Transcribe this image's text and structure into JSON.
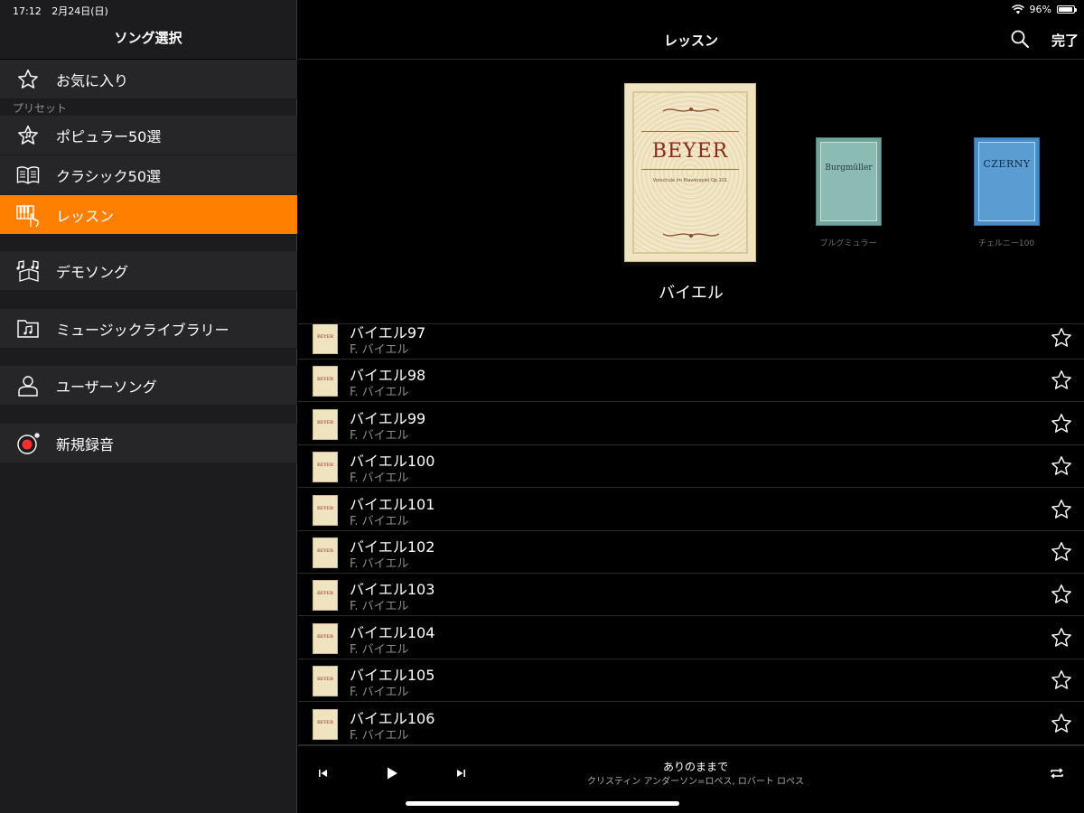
{
  "status_bar": {
    "time": "17:12",
    "date": "2月24日(日)",
    "battery": "96%",
    "battery_level": 0.96
  },
  "sidebar": {
    "title": "ソング選択",
    "favorites": {
      "label": "お気に入り",
      "icon": "star-outline-icon"
    },
    "preset_label": "プリセット",
    "items": [
      {
        "label": "ポピュラー50選",
        "icon": "star-with-notes-icon"
      },
      {
        "label": "クラシック50選",
        "icon": "open-book-icon"
      },
      {
        "label": "レッスン",
        "icon": "piano-hand-icon",
        "active": true
      },
      {
        "label": "デモソング",
        "icon": "music-notes-box-icon"
      },
      {
        "label": "ミュージックライブラリー",
        "icon": "music-folder-icon"
      },
      {
        "label": "ユーザーソング",
        "icon": "user-icon"
      },
      {
        "label": "新規録音",
        "icon": "record-icon"
      }
    ]
  },
  "header": {
    "title": "レッスン",
    "done_label": "完了"
  },
  "books": {
    "selected": {
      "cover_title": "BEYER",
      "cover_subtitle": "Vorschule im Klavierspiel Op.101",
      "label": "バイエル"
    },
    "others": [
      {
        "cover_title": "Burgmüller",
        "caption": "ブルグミュラー",
        "color": "#6fa49d"
      },
      {
        "cover_title": "CZERNY",
        "caption": "チェルニー100",
        "color": "#4a8bc4"
      }
    ]
  },
  "songs": [
    {
      "title": "バイエル97",
      "artist": "F. バイエル"
    },
    {
      "title": "バイエル98",
      "artist": "F. バイエル"
    },
    {
      "title": "バイエル99",
      "artist": "F. バイエル"
    },
    {
      "title": "バイエル100",
      "artist": "F. バイエル"
    },
    {
      "title": "バイエル101",
      "artist": "F. バイエル"
    },
    {
      "title": "バイエル102",
      "artist": "F. バイエル"
    },
    {
      "title": "バイエル103",
      "artist": "F. バイエル"
    },
    {
      "title": "バイエル104",
      "artist": "F. バイエル"
    },
    {
      "title": "バイエル105",
      "artist": "F. バイエル"
    },
    {
      "title": "バイエル106",
      "artist": "F. バイエル"
    }
  ],
  "song_thumb_label": "BEYER",
  "player": {
    "now_playing_title": "ありのままで",
    "now_playing_artist": "クリスティン アンダーソン=ロペス, ロバート ロペス"
  },
  "colors": {
    "accent": "#ff7f00",
    "sidebar_bg": "#1c1c1e",
    "row_bg": "#262628"
  }
}
